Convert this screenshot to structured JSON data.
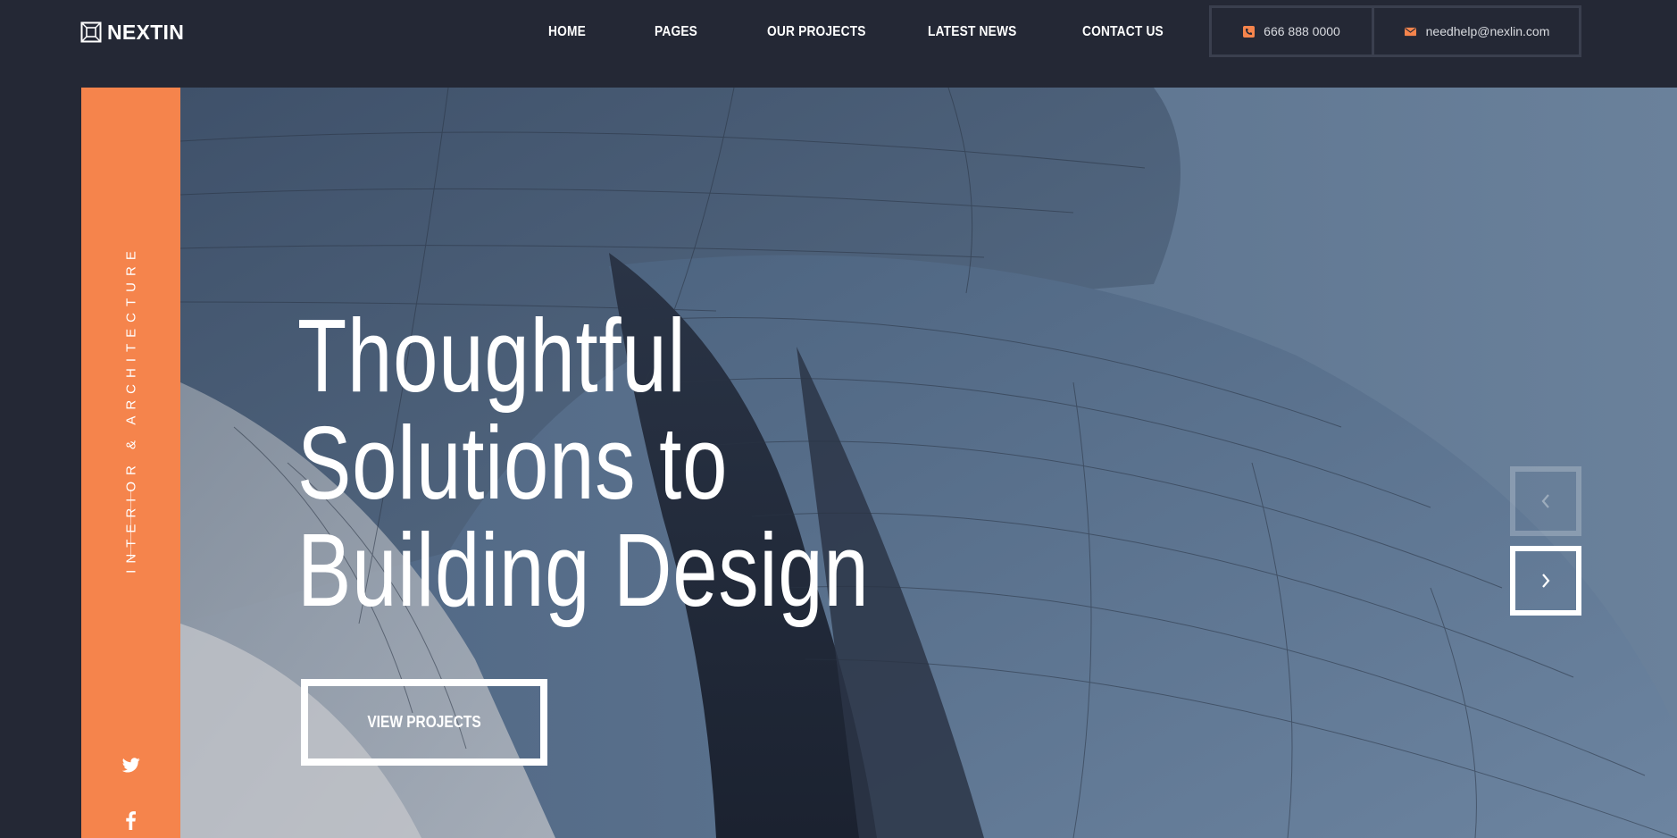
{
  "brand": {
    "name": "NEXTIN",
    "logo_icon": "building-frame-icon"
  },
  "nav": {
    "items": [
      {
        "label": "HOME"
      },
      {
        "label": "PAGES"
      },
      {
        "label": "OUR PROJECTS"
      },
      {
        "label": "LATEST NEWS"
      },
      {
        "label": "CONTACT US"
      }
    ]
  },
  "contact": {
    "phone": {
      "icon": "phone-icon",
      "text": "666 888 0000"
    },
    "email": {
      "icon": "envelope-icon",
      "text": "needhelp@nexlin.com"
    }
  },
  "sidebar": {
    "tagline": "INTERIOR & ARCHITECTURE",
    "socials": [
      {
        "icon": "twitter-icon"
      },
      {
        "icon": "facebook-icon"
      }
    ]
  },
  "hero": {
    "headline_lines": [
      "Thoughtful",
      "Solutions to",
      "Building Design"
    ],
    "cta_label": "VIEW PROJECTS",
    "prev_icon": "chevron-left-icon",
    "next_icon": "chevron-right-icon"
  },
  "colors": {
    "background": "#242835",
    "accent": "#f5844c",
    "text": "#ffffff"
  }
}
